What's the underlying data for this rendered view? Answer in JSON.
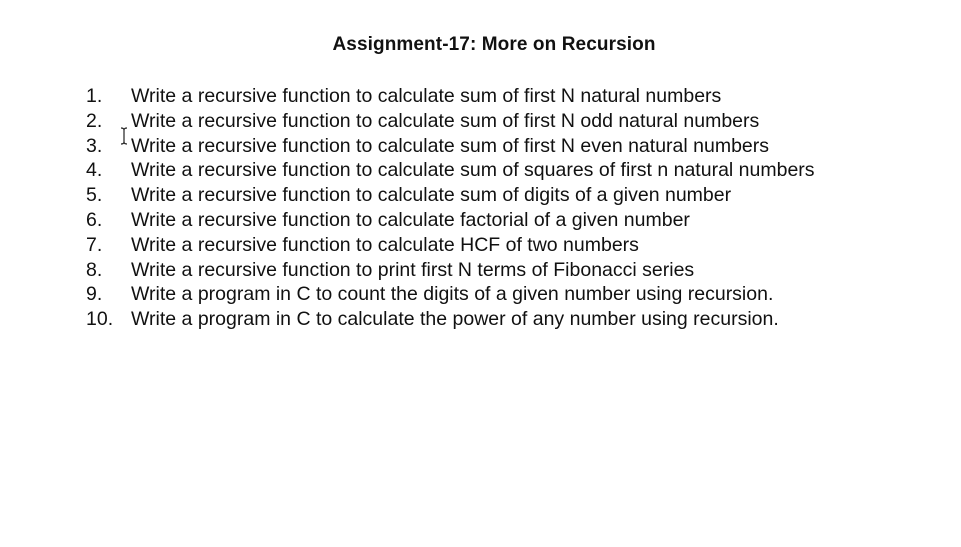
{
  "document": {
    "title": "Assignment-17: More on Recursion",
    "items": [
      {
        "number": "1.",
        "text": "Write a recursive function to calculate sum of first N natural numbers"
      },
      {
        "number": "2.",
        "text": "Write a recursive function to calculate sum of first N odd natural numbers"
      },
      {
        "number": "3.",
        "text": "Write a recursive function to calculate sum of first N even natural numbers"
      },
      {
        "number": "4.",
        "text": "Write a recursive function to calculate sum of squares of first n natural numbers"
      },
      {
        "number": "5.",
        "text": "Write a recursive function to calculate sum of digits of a given number"
      },
      {
        "number": "6.",
        "text": "Write a recursive function to calculate factorial of a given number"
      },
      {
        "number": "7.",
        "text": "Write a recursive function to calculate HCF of two numbers"
      },
      {
        "number": "8.",
        "text": "Write a recursive function to print first N terms of Fibonacci series"
      },
      {
        "number": "9.",
        "text": "Write a program in C to count the digits of a given number using recursion."
      },
      {
        "number": "10.",
        "text": "Write a program in C to calculate the power of any number using recursion."
      }
    ]
  },
  "cursor": {
    "icon": "text-cursor-icon"
  }
}
